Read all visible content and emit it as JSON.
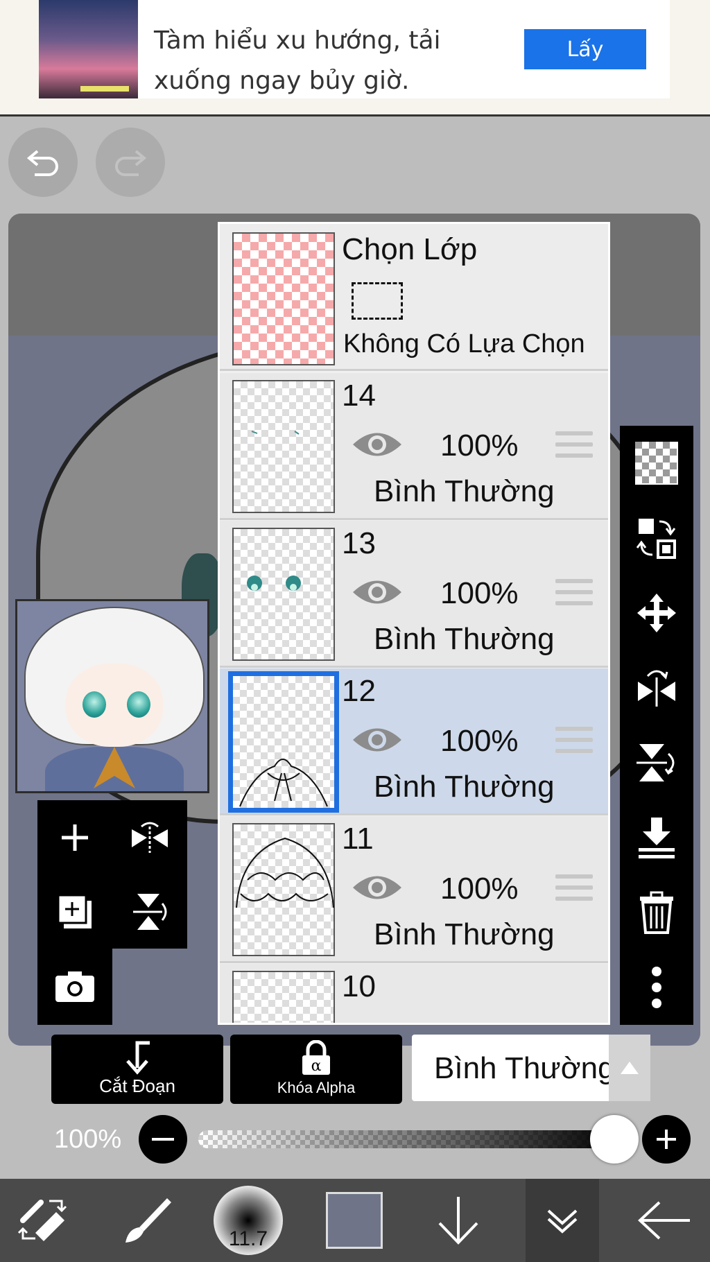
{
  "ad": {
    "text": "Tàm hiểu xu hướng, tải xuống ngay bủy giờ.",
    "button": "Lấy"
  },
  "selection_layer": {
    "title": "Chọn Lớp",
    "status": "Không Có Lựa Chọn"
  },
  "layers": [
    {
      "number": "14",
      "opacity": "100%",
      "blend": "Bình Thường",
      "selected": false
    },
    {
      "number": "13",
      "opacity": "100%",
      "blend": "Bình Thường",
      "selected": false
    },
    {
      "number": "12",
      "opacity": "100%",
      "blend": "Bình Thường",
      "selected": true
    },
    {
      "number": "11",
      "opacity": "100%",
      "blend": "Bình Thường",
      "selected": false
    },
    {
      "number": "10"
    }
  ],
  "actions": {
    "clipping_label": "Cắt Đoạn",
    "alpha_lock_label": "Khóa Alpha",
    "blend_mode": "Bình Thường"
  },
  "opacity": {
    "label": "100%",
    "value": 1.0
  },
  "toolbar": {
    "brush_size": "11.7",
    "current_color": "#6f7489"
  },
  "icons": {
    "undo": "undo-icon",
    "redo": "redo-icon",
    "add_layer": "plus-icon",
    "duplicate_layer": "duplicate-icon",
    "camera": "camera-icon",
    "flip_horizontal": "flip-horizontal-icon",
    "flip_vertical": "flip-vertical-icon",
    "transparency": "checker-icon",
    "swap": "swap-icon",
    "move": "move-icon",
    "merge_down": "merge-down-icon",
    "delete": "trash-icon",
    "more": "more-vertical-icon"
  },
  "colors": {
    "selected_layer_bg": "#cdd9ea",
    "selected_layer_border": "#1f6fe0",
    "ad_button": "#1a73e8"
  }
}
